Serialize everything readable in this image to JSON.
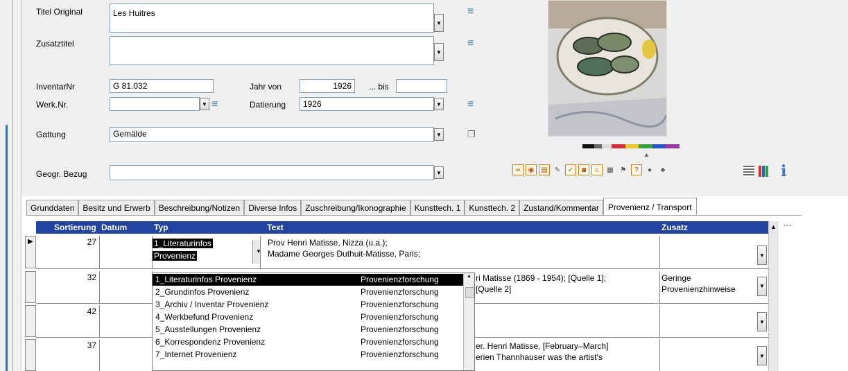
{
  "form": {
    "titel_original_label": "Titel Original",
    "titel_original_value": "Les Huitres",
    "zusatztitel_label": "Zusatztitel",
    "zusatztitel_value": "",
    "inventarnr_label": "InventarNr",
    "inventarnr_value": "G 81.032",
    "jahr_von_label": "Jahr von",
    "jahr_von_value": "1926",
    "bis_label": "... bis",
    "bis_value": "",
    "werknr_label": "Werk.Nr.",
    "werknr_value": "",
    "datierung_label": "Datierung",
    "datierung_value": "1926",
    "gattung_label": "Gattung",
    "gattung_value": "Gemälde",
    "geogr_label": "Geogr. Bezug",
    "geogr_value": ""
  },
  "tabs": [
    {
      "label": "Grunddaten"
    },
    {
      "label": "Besitz und Erwerb"
    },
    {
      "label": "Beschreibung/Notizen"
    },
    {
      "label": "Diverse Infos"
    },
    {
      "label": "Zuschreibung/Ikonographie"
    },
    {
      "label": "Kunsttech. 1"
    },
    {
      "label": "Kunsttech. 2"
    },
    {
      "label": "Zustand/Kommentar"
    },
    {
      "label": "Provenienz / Transport"
    }
  ],
  "grid": {
    "headers": {
      "sort": "Sortierung",
      "datum": "Datum",
      "typ": "Typ",
      "text": "Text",
      "zusatz": "Zusatz"
    },
    "rows": [
      {
        "sort": "27",
        "typ1": "1_Literaturinfos",
        "typ2": "Provenienz",
        "text1": "Prov Henri Matisse, Nizza (u.a.);",
        "text2": "Madame Georges Duthuit-Matisse, Paris;",
        "zusatz": ""
      },
      {
        "sort": "32",
        "text1": "ri Matisse (1869 - 1954); [Quelle 1];",
        "text2": "[Quelle 2]",
        "zusatz1": "Geringe",
        "zusatz2": "Provenienzhinweise"
      },
      {
        "sort": "42",
        "text1": "",
        "zusatz": ""
      },
      {
        "sort": "37",
        "text1": "er. Henri Matisse, [February–March]",
        "text2": "erien Thannhauser was the artist's",
        "zusatz": ""
      }
    ]
  },
  "dropdown": {
    "items": [
      {
        "name": "1_Literaturinfos Provenienz",
        "cat": "Provenienzforschung"
      },
      {
        "name": "2_Grundinfos Provenienz",
        "cat": "Provenienzforschung"
      },
      {
        "name": "3_Archiv / Inventar Provenienz",
        "cat": "Provenienzforschung"
      },
      {
        "name": "4_Werkbefund Provenienz",
        "cat": "Provenienzforschung"
      },
      {
        "name": "5_Ausstellungen Provenienz",
        "cat": "Provenienzforschung"
      },
      {
        "name": "6_Korrespondenz Provenienz",
        "cat": "Provenienzforschung"
      },
      {
        "name": "7_Internet Provenienz",
        "cat": "Provenienzforschung"
      }
    ]
  },
  "toolbar_icons": [
    "link-icon",
    "eye-icon",
    "document-icon",
    "stamp-icon",
    "checkmark-icon",
    "camera-icon",
    "house-icon",
    "ruler-icon",
    "flag-icon",
    "help-icon",
    "record-icon",
    "tree-icon"
  ],
  "colors": {
    "grid_header": "#2244a0",
    "selected_item": "#000000",
    "icon_blue": "#4a7fc1"
  }
}
